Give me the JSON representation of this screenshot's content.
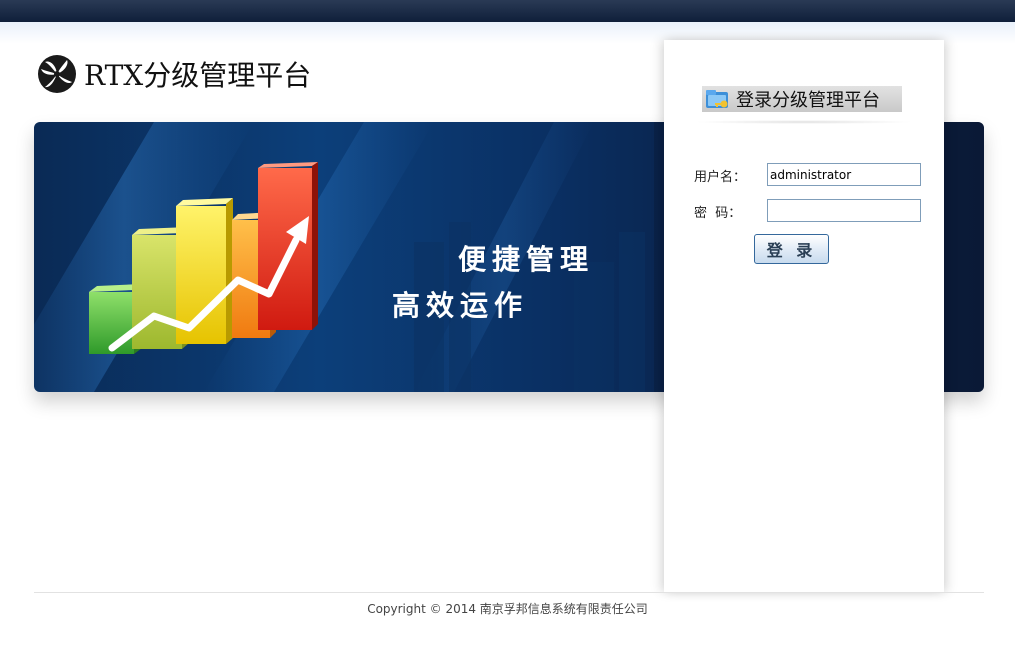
{
  "header": {
    "logo_icon": "pinwheel-logo-icon",
    "app_title": "RTX分级管理平台"
  },
  "banner": {
    "slogan_line1": "便捷管理",
    "slogan_line2": "高效运作",
    "graphic": "bar-chart-with-arrow-icon"
  },
  "login": {
    "title": "登录分级管理平台",
    "title_icon": "folder-key-icon",
    "username_label": "用户名：",
    "username_value": "administrator",
    "password_label": "密  码：",
    "password_value": "",
    "login_button_label": "登 录"
  },
  "footer": {
    "copyright": "Copyright © 2014 南京孚邦信息系统有限责任公司"
  },
  "colors": {
    "topbar": "#0f1f3a",
    "banner_blue": "#0c3f7a",
    "input_border": "#7f9db9",
    "button_border": "#34689c"
  }
}
